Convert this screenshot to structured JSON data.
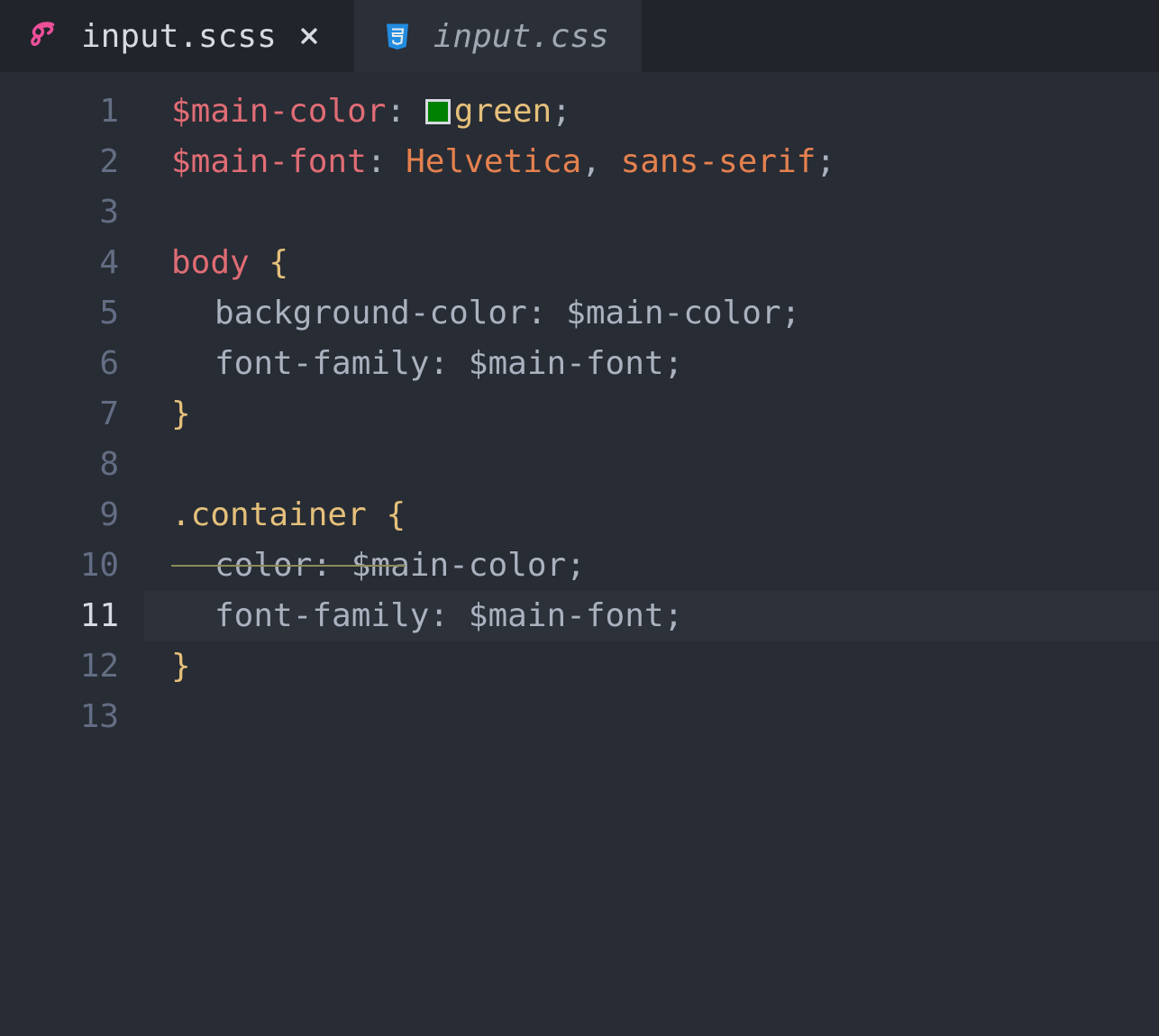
{
  "tabs": [
    {
      "label": "input.scss",
      "active": true,
      "icon": "sass-icon",
      "close": true
    },
    {
      "label": "input.css",
      "active": false,
      "icon": "css3-icon",
      "close": false
    }
  ],
  "colors": {
    "sass_pink": "#ed4f99",
    "css_blue": "#2196f3",
    "green_swatch": "#008000"
  },
  "current_line": 11,
  "line_count": 13,
  "code": {
    "l1": {
      "var": "$main-color",
      "colon": ":",
      "val": "green",
      "semi": ";"
    },
    "l2": {
      "var": "$main-font",
      "colon": ":",
      "val1": "Helvetica",
      "comma": ",",
      "val2": "sans-serif",
      "semi": ";"
    },
    "l4": {
      "sel": "body",
      "brace": "{"
    },
    "l5": {
      "prop": "background-color",
      "colon": ":",
      "val": "$main-color",
      "semi": ";"
    },
    "l6": {
      "prop": "font-family",
      "colon": ":",
      "val": "$main-font",
      "semi": ";"
    },
    "l7": {
      "brace": "}"
    },
    "l9": {
      "sel": ".container",
      "brace": "{"
    },
    "l10": {
      "prop": "color",
      "colon": ":",
      "val": "$main-color",
      "semi": ";"
    },
    "l11": {
      "prop": "font-family",
      "colon": ":",
      "val": "$main-font",
      "semi": ";"
    },
    "l12": {
      "brace": "}"
    }
  }
}
